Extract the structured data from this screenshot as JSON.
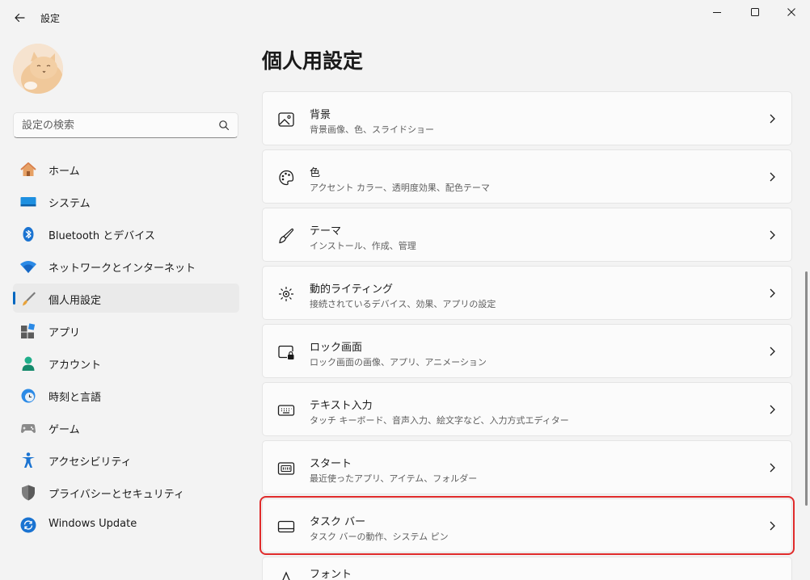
{
  "window": {
    "title": "設定"
  },
  "search": {
    "placeholder": "設定の検索"
  },
  "sidebar": {
    "items": [
      {
        "label": "ホーム"
      },
      {
        "label": "システム"
      },
      {
        "label": "Bluetooth とデバイス"
      },
      {
        "label": "ネットワークとインターネット"
      },
      {
        "label": "個人用設定"
      },
      {
        "label": "アプリ"
      },
      {
        "label": "アカウント"
      },
      {
        "label": "時刻と言語"
      },
      {
        "label": "ゲーム"
      },
      {
        "label": "アクセシビリティ"
      },
      {
        "label": "プライバシーとセキュリティ"
      },
      {
        "label": "Windows Update"
      }
    ],
    "active_index": 4
  },
  "main": {
    "title": "個人用設定",
    "cards": [
      {
        "title": "背景",
        "subtitle": "背景画像、色、スライドショー",
        "icon": "image-icon"
      },
      {
        "title": "色",
        "subtitle": "アクセント カラー、透明度効果、配色テーマ",
        "icon": "palette-icon"
      },
      {
        "title": "テーマ",
        "subtitle": "インストール、作成、管理",
        "icon": "brush-icon"
      },
      {
        "title": "動的ライティング",
        "subtitle": "接続されているデバイス、効果、アプリの設定",
        "icon": "lighting-icon"
      },
      {
        "title": "ロック画面",
        "subtitle": "ロック画面の画像、アプリ、アニメーション",
        "icon": "lock-screen-icon"
      },
      {
        "title": "テキスト入力",
        "subtitle": "タッチ キーボード、音声入力、絵文字など、入力方式エディター",
        "icon": "keyboard-icon"
      },
      {
        "title": "スタート",
        "subtitle": "最近使ったアプリ、アイテム、フォルダー",
        "icon": "start-icon"
      },
      {
        "title": "タスク バー",
        "subtitle": "タスク バーの動作、システム ピン",
        "icon": "taskbar-icon"
      },
      {
        "title": "フォント",
        "subtitle": "",
        "icon": "font-icon"
      }
    ],
    "selected_index": 7
  },
  "colors": {
    "accent": "#0067c0",
    "highlight_border": "#e02b2b"
  }
}
